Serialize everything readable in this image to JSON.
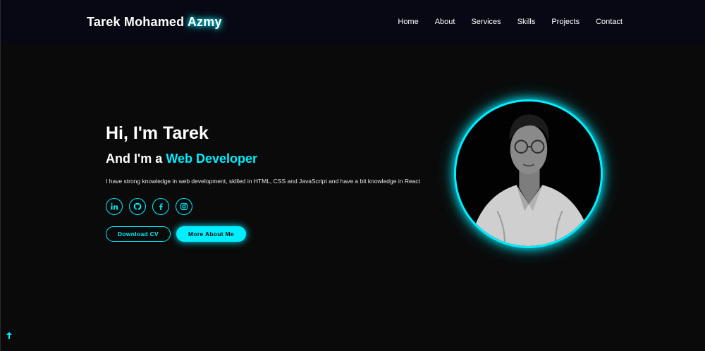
{
  "header": {
    "logo_first": "Tarek Mohamed",
    "logo_accent": "Azmy",
    "nav": [
      "Home",
      "About",
      "Services",
      "Skills",
      "Projects",
      "Contact"
    ]
  },
  "hero": {
    "title": "Hi, I'm Tarek",
    "subtitle_prefix": "And I'm a",
    "subtitle_role": "Web Developer",
    "description": "I have strong knowledge in web development, skilled in HTML, CSS and JavaScript and have a bit knowledge in React",
    "socials": [
      "linkedin-icon",
      "github-icon",
      "facebook-icon",
      "instagram-icon"
    ],
    "download_label": "Download CV",
    "more_label": "More About Me"
  },
  "colors": {
    "accent": "#00eeff",
    "background": "#0a0a0a",
    "header_bg": "#080814"
  }
}
